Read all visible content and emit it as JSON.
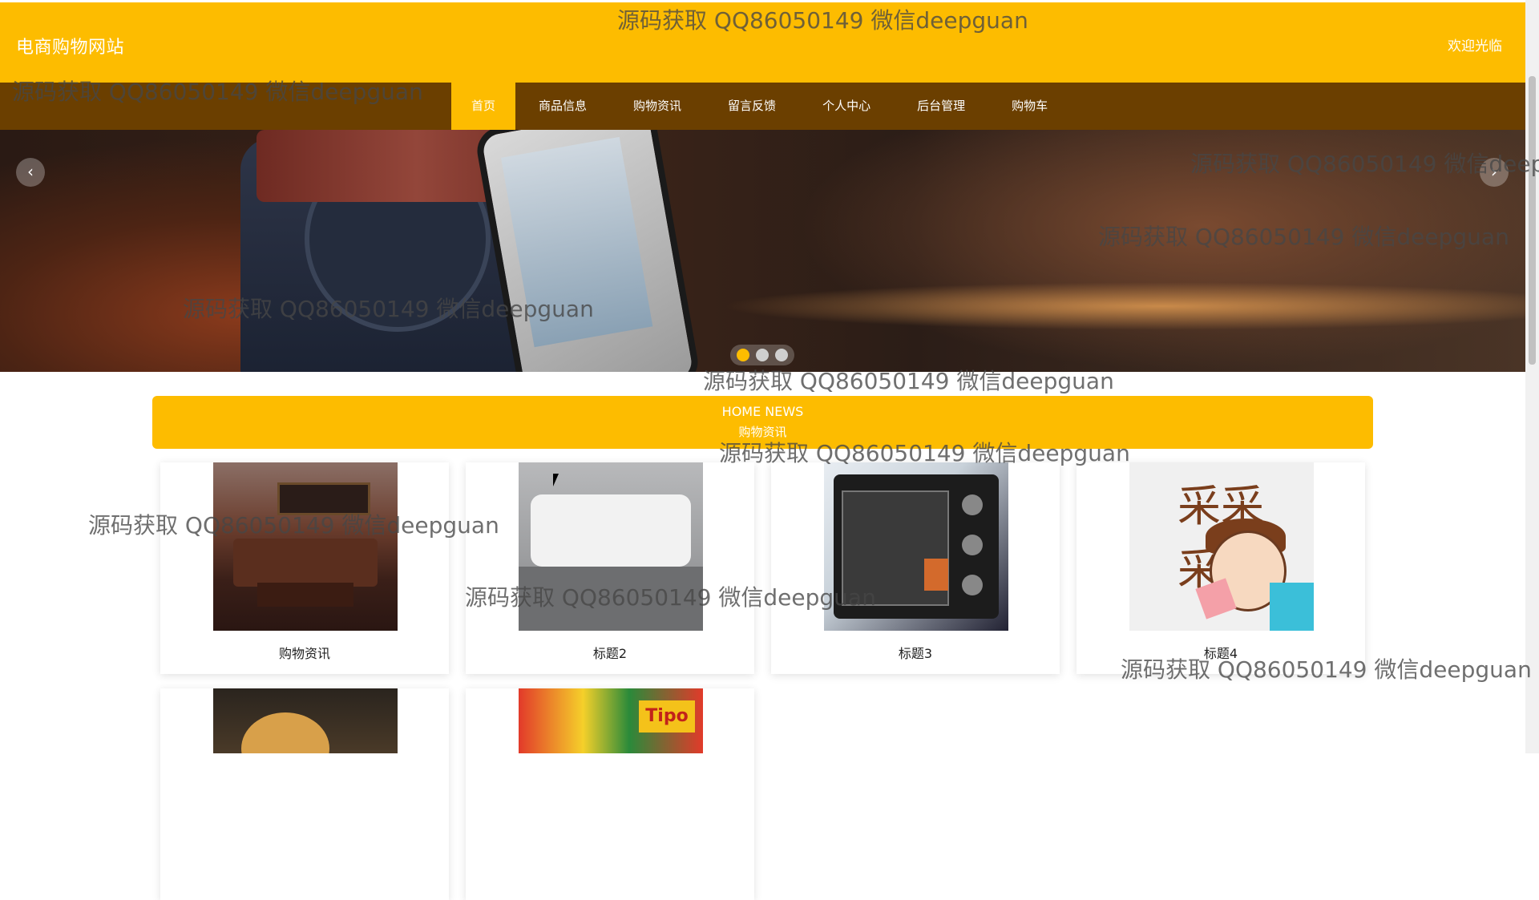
{
  "header": {
    "site_title": "电商购物网站",
    "welcome": "欢迎光临",
    "nav": [
      "首页",
      "商品信息",
      "购物资讯",
      "留言反馈",
      "个人中心",
      "后台管理",
      "购物车"
    ],
    "active_nav": "首页"
  },
  "carousel": {
    "slides": 3,
    "active_slide": 1,
    "prev_icon": "chevron-left-icon",
    "next_icon": "chevron-right-icon"
  },
  "news_section": {
    "title_en": "HOME NEWS",
    "title_cn": "购物资讯"
  },
  "cards": [
    {
      "caption": "购物资讯",
      "image": "living-room-furniture"
    },
    {
      "caption": "标题2",
      "image": "white-sofa"
    },
    {
      "caption": "标题3",
      "image": "microwave-oven"
    },
    {
      "caption": "标题4",
      "image": "cartoon-shopping"
    },
    {
      "caption": "",
      "image": "snack-food"
    },
    {
      "caption": "",
      "image": "packaged-snacks"
    }
  ],
  "watermark": "源码获取 QQ86050149 微信deepguan",
  "card_image_text": {
    "cartoon": "采采采!",
    "chips": "Tipo"
  },
  "colors": {
    "primary": "#FDBC00",
    "nav_bg": "#6B3F00",
    "text_light": "#FFFFFF"
  }
}
